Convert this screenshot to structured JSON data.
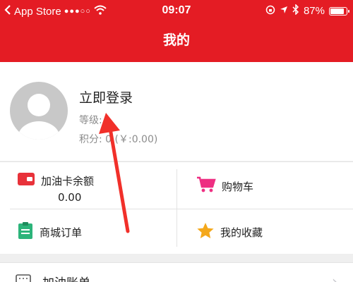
{
  "status_bar": {
    "back_app": "App Store",
    "time": "09:07",
    "battery": "87%",
    "battery_level": 0.87
  },
  "header": {
    "title": "我的"
  },
  "profile": {
    "login": "立即登录",
    "level": "等级:",
    "points": "积分: 0 (￥:0.00)"
  },
  "grid": {
    "fuel_card_label": "加油卡余额",
    "fuel_card_value": "0.00",
    "cart_label": "购物车",
    "orders_label": "商城订单",
    "favorites_label": "我的收藏"
  },
  "list": {
    "fuel_bill_label": "加油账单"
  },
  "colors": {
    "brand_red": "#e41c24"
  }
}
